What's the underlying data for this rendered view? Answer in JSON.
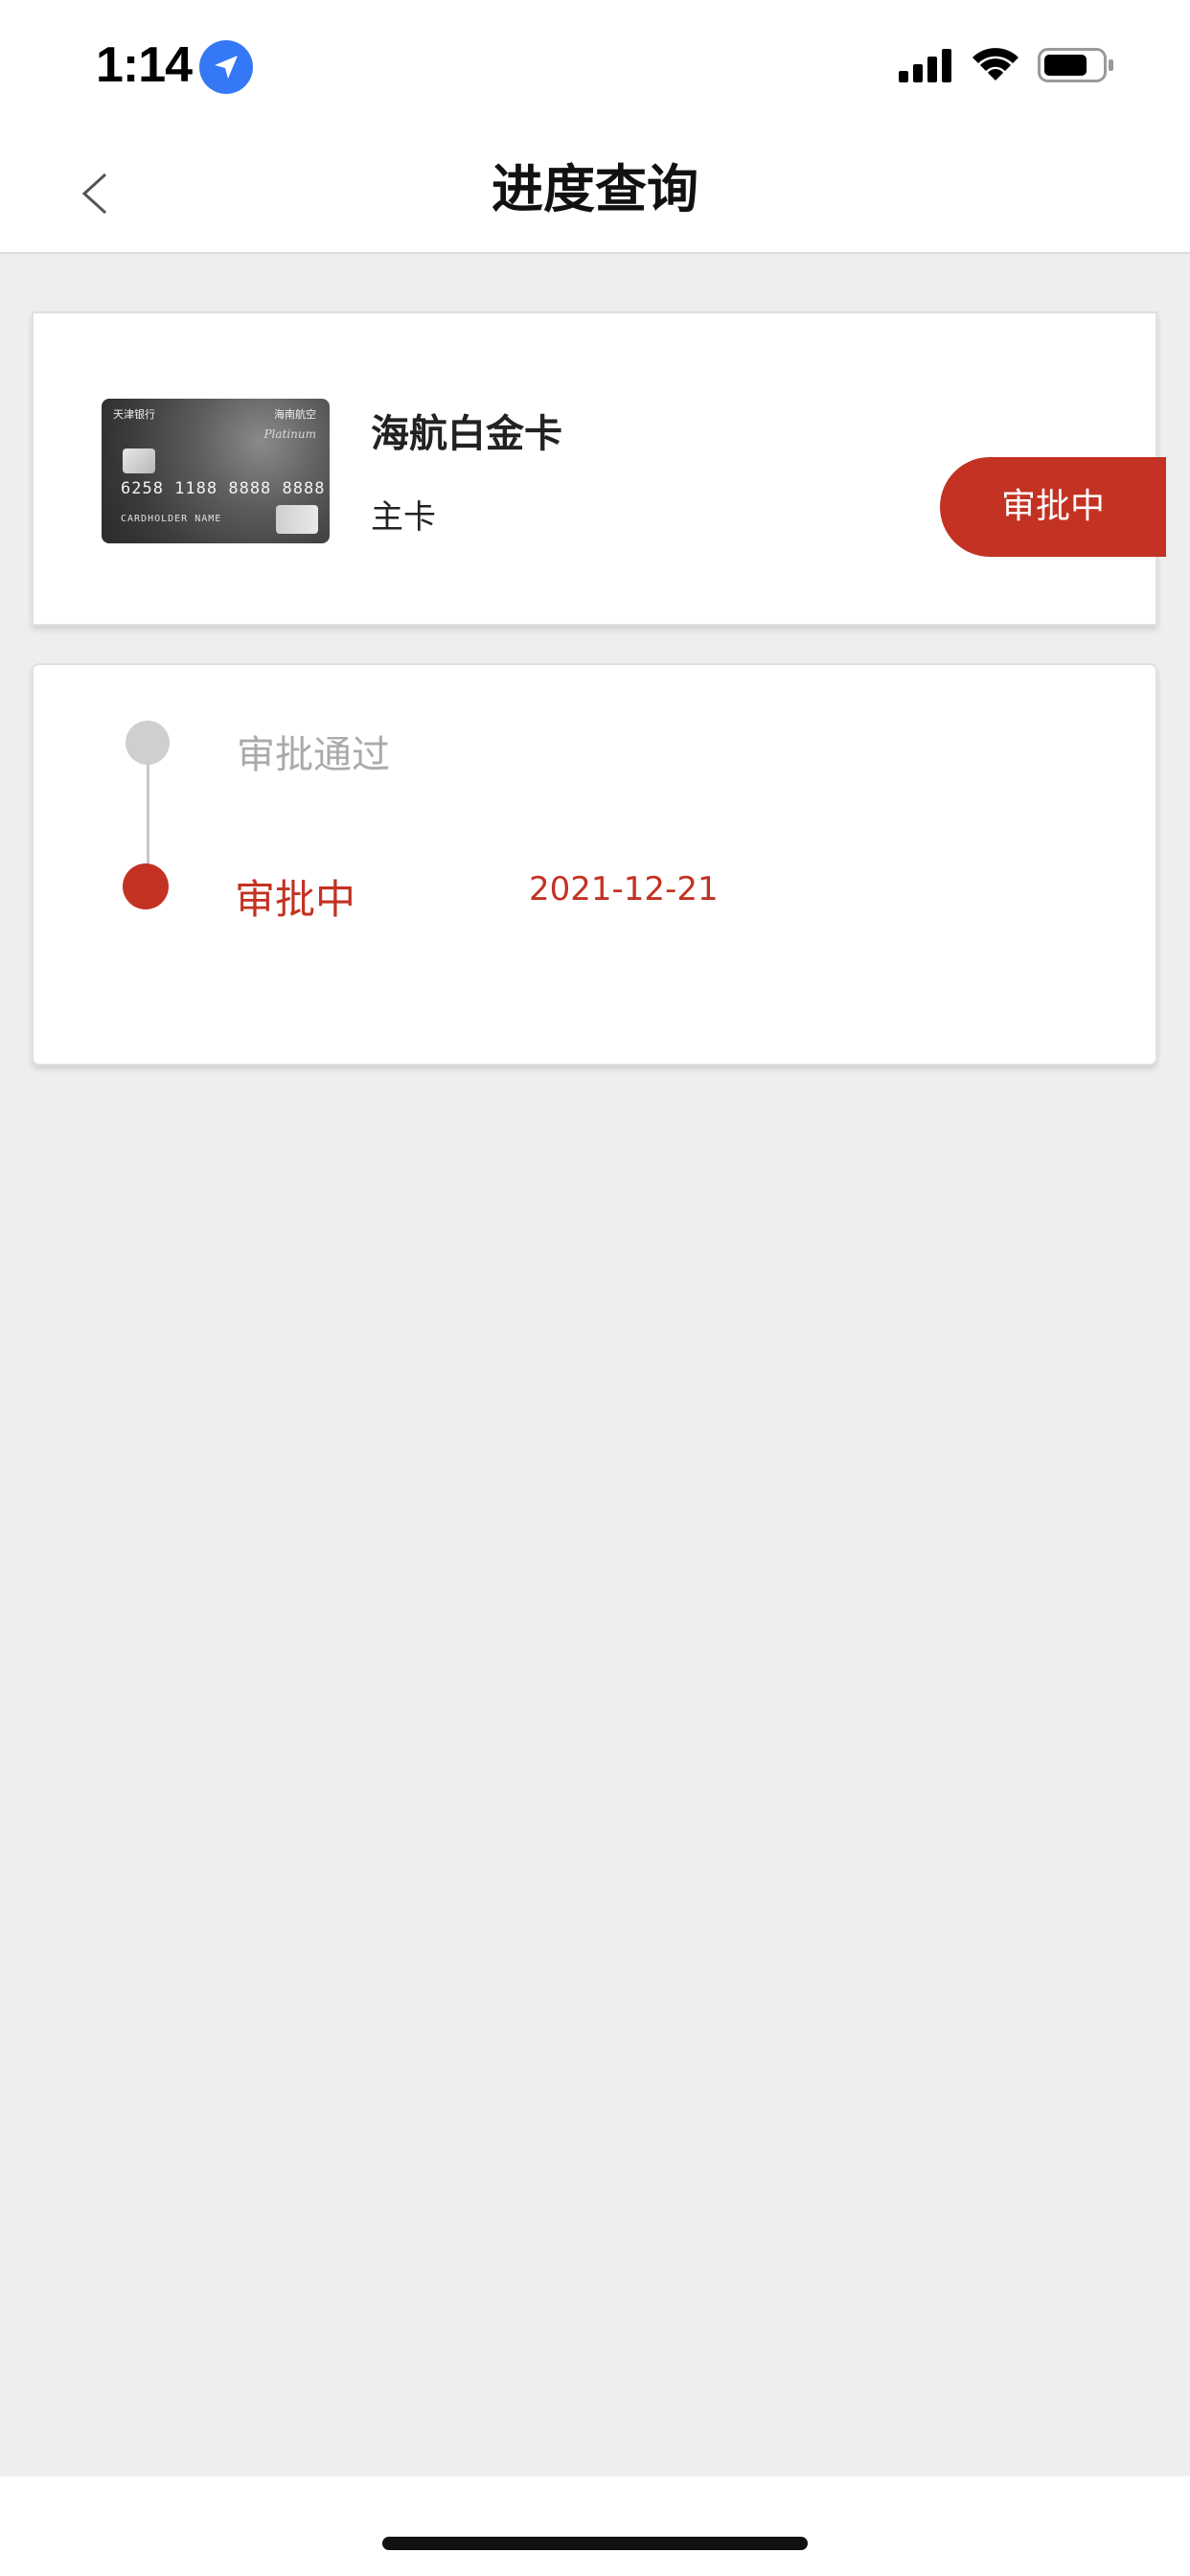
{
  "status_bar": {
    "time": "1:14",
    "icons": [
      "location-arrow-icon",
      "cellular-signal-icon",
      "wifi-icon",
      "battery-icon"
    ]
  },
  "nav": {
    "title": "进度查询",
    "back_icon": "chevron-left-icon"
  },
  "card": {
    "name": "海航白金卡",
    "type": "主卡",
    "status": "审批中",
    "image": {
      "bank": "天津银行",
      "partner": "海南航空",
      "tier": "Platinum",
      "number": "6258 1188 8888 8888",
      "holder": "CARDHOLDER NAME"
    }
  },
  "timeline": {
    "steps": [
      {
        "label": "审批通过",
        "date": "",
        "state": "done"
      },
      {
        "label": "审批中",
        "date": "2021-12-21",
        "state": "current"
      }
    ]
  },
  "colors": {
    "accent": "#c33222",
    "background": "#eeeeee",
    "inactive": "#cfcfcf",
    "ios_blue": "#3478f6"
  }
}
